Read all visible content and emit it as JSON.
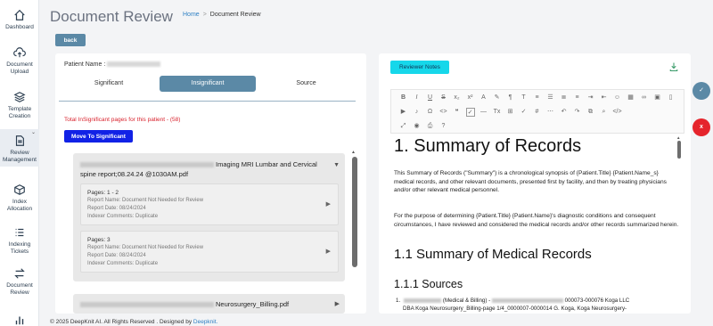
{
  "sidebar": {
    "items": [
      {
        "label": "Dashboard",
        "icon": "home-icon"
      },
      {
        "label": "Document Upload",
        "icon": "cloud-upload-icon"
      },
      {
        "label": "Template Creation",
        "icon": "layers-icon"
      },
      {
        "label": "Review Management",
        "icon": "document-icon"
      },
      {
        "label": "Index Allocation",
        "icon": "cube-icon"
      },
      {
        "label": "Indexing Tickets",
        "icon": "list-icon"
      },
      {
        "label": "Document Review",
        "icon": "swap-icon"
      },
      {
        "label": "",
        "icon": "bar-chart-icon"
      }
    ]
  },
  "header": {
    "title": "Document Review",
    "breadcrumb_home": "Home",
    "breadcrumb_sep": ">",
    "breadcrumb_current": "Document Review"
  },
  "back_label": "back",
  "left": {
    "patient_label": "Patient Name :",
    "tabs": [
      "Significant",
      "Insignificant",
      "Source"
    ],
    "total_text": "Total InSignificant pages for this patient - (58)",
    "move_label": "Move To Significant",
    "docs": [
      {
        "title": "Imaging MRI Lumbar and Cervical spine report;08.24.24 @1030AM.pdf",
        "toggle": "▼",
        "pages": [
          {
            "pages": "Pages: 1 - 2",
            "report_name": "Report Name: Document Not Needed for Review",
            "report_date": "Report Date: 08/24/2024",
            "comments": "Indexer Comments: Duplicate"
          },
          {
            "pages": "Pages: 3",
            "report_name": "Report Name: Document Not Needed for Review",
            "report_date": "Report Date: 08/24/2024",
            "comments": "Indexer Comments: Duplicate"
          }
        ]
      },
      {
        "title": "Neurosurgery_Billing.pdf",
        "toggle": "▶"
      }
    ]
  },
  "right": {
    "reviewer_notes_label": "Reviewer Notes",
    "editor": {
      "h1": "1. Summary of Records",
      "p1": "This Summary of Records (\"Summary\") is a chronological synopsis of {Patient.Title} {Patient.Name_s} medical records, and other relevant documents, presented first by facility, and then by treating physicians and/or other relevant medical personnel.",
      "p2": "For the purpose of determining {Patient.Title} {Patient.Name}'s diagnostic conditions and consequent circumstances, I have reviewed and considered the medical records and/or other records summarized herein.",
      "h2": "1.1 Summary of Medical Records",
      "h3": "1.1.1 Sources",
      "li_line1_a": "(Medical & Billing) -",
      "li_line1_b": "000073-000076 Koga LLC",
      "li_line2": "DBA Koga Neurosurgery_Billing-page 1/4_0000007-0000014 G. Koga, Koga Neurosurgery-"
    }
  },
  "footer": {
    "text": "© 2025 DeepKnit AI. All Rights Reserved . Designed by",
    "link": "Deepknit."
  },
  "colors": {
    "accent": "#5b89a6",
    "move_button": "#1122e6",
    "reviewer_button": "#16d7ea",
    "danger": "#e5242c"
  }
}
